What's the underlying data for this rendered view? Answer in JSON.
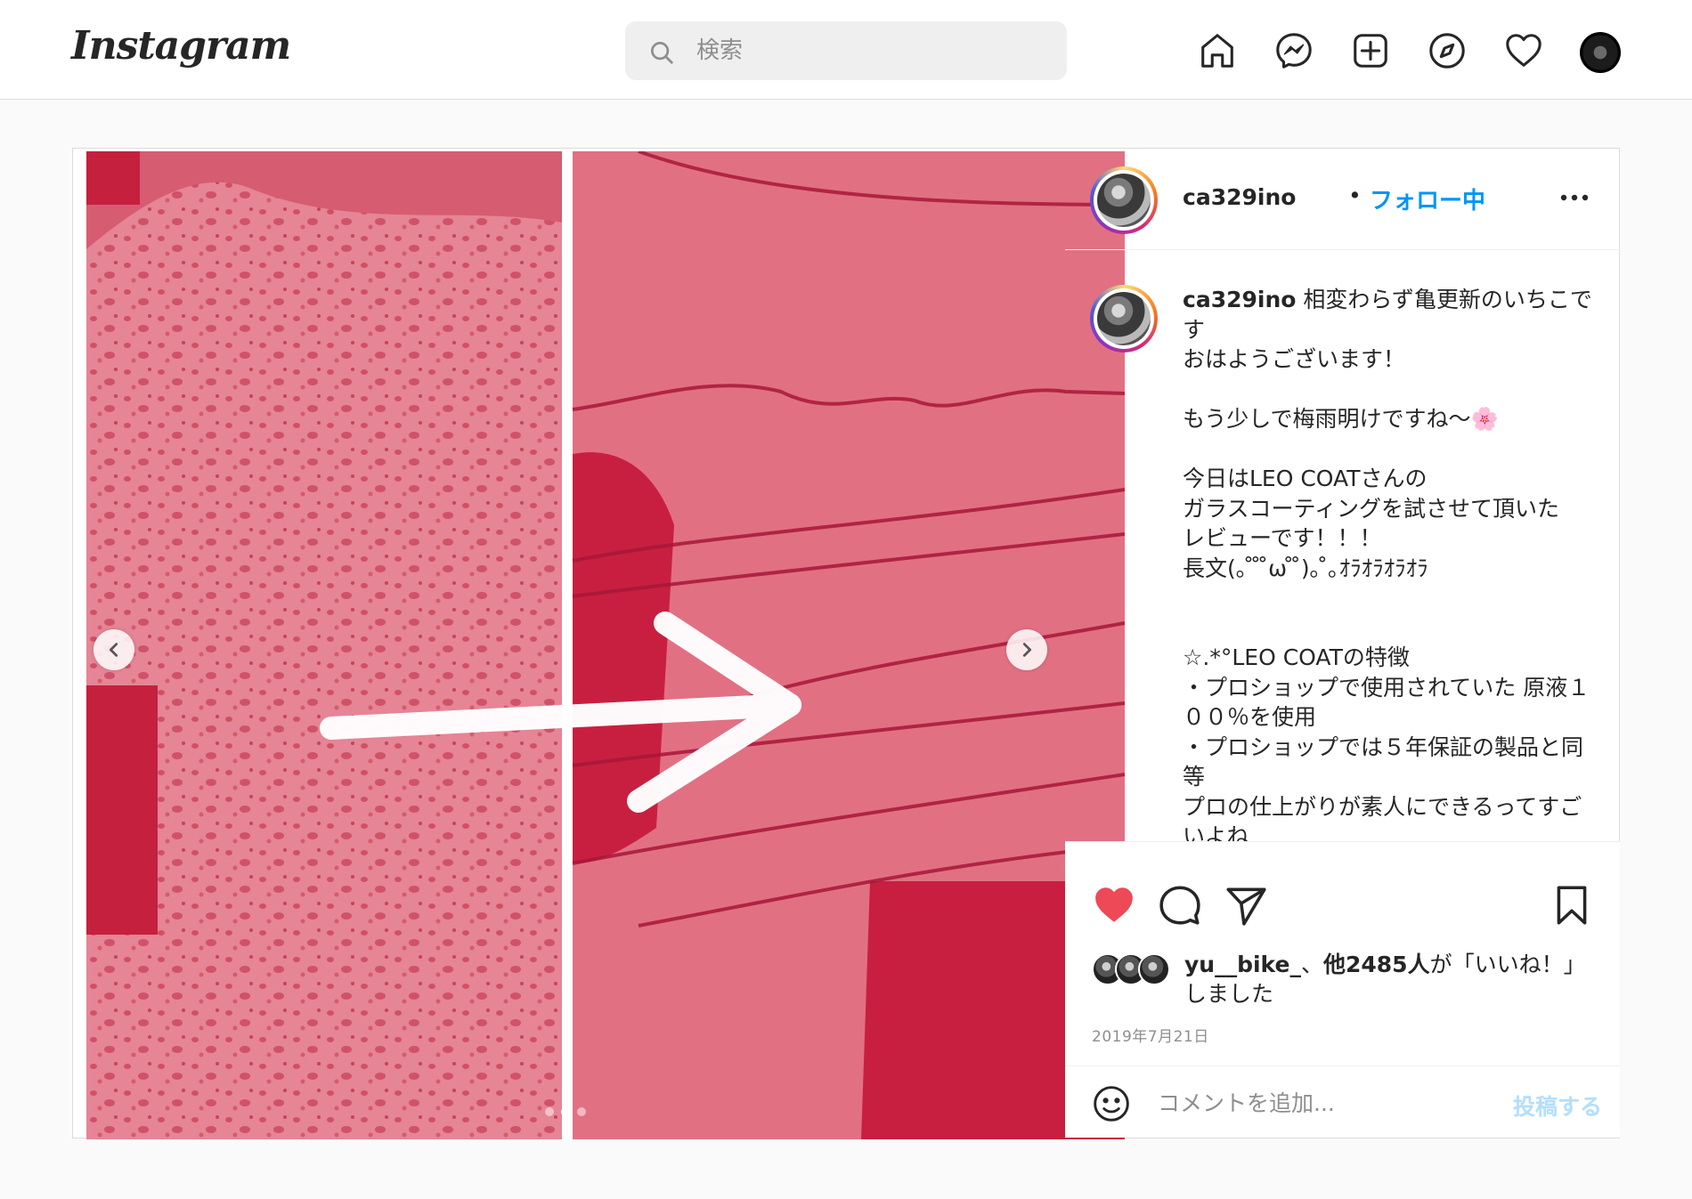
{
  "app": {
    "logo_text": "Instagram"
  },
  "search": {
    "placeholder": "検索"
  },
  "nav": {
    "icons": [
      "home-icon",
      "messenger-icon",
      "new-post-icon",
      "explore-icon",
      "activity-heart-icon",
      "profile-avatar"
    ]
  },
  "post": {
    "username": "ca329ino",
    "separator": "•",
    "follow_status": "フォロー中",
    "caption_text": "相変わらず亀更新のいちこです\nおはようございます！\n\nもう少しで梅雨明けですね〜🌸\n\n今日はLEO COATさんの\nガラスコーティングを試させて頂いた\nレビューです！！！\n長文(｡ ̊ ̊ ̊ω ̊ ̊)｡ ̊｡ｵﾗｵﾗｵﾗｵﾗ\n\n\n☆.*°LEO COATの特徴\n・プロショップで使用されていた 原液１００％を使用\n・プロショップでは５年保証の製品と同等\nプロの仕上がりが素人にできるってすごいよね",
    "liked_by_user": "yu__bike_",
    "liked_by_connector": "、",
    "liked_by_others": "他2485人",
    "liked_by_suffix": "が「いいね！」しました",
    "date": "2019年7月21日",
    "carousel": {
      "current_slide": 2,
      "total_slides": 3
    },
    "liked": true
  },
  "comment": {
    "placeholder": "コメントを追加...",
    "post_button": "投稿する"
  },
  "colors": {
    "accent_blue": "#0095f6",
    "like_red": "#ed4956",
    "post_button_disabled": "#b2dffc",
    "muted_text": "#8e8e8e",
    "border": "#dbdbdb"
  }
}
